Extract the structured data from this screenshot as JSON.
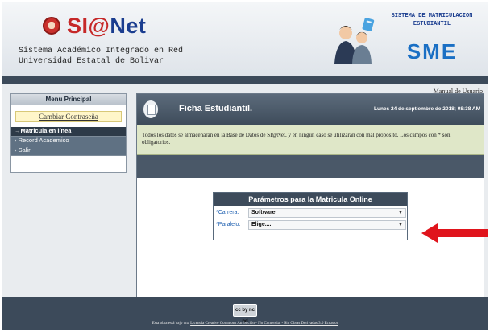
{
  "header": {
    "logo_prefix": "SI@",
    "logo_suffix": "Net",
    "tagline_line1": "Sistema Académico Integrado en Red",
    "tagline_line2": "Universidad Estatal de Bolivar",
    "sme_caption": "Sistema de matriculacion estudiantil",
    "sme_title": "SME"
  },
  "topbar": {
    "manual_label": "Manual de Usuario"
  },
  "sidebar": {
    "title": "Menu Principal",
    "change_password": "Cambiar Contraseña",
    "items": [
      {
        "label": "→Matricula en línea",
        "active": true
      },
      {
        "label": "› Record Academico",
        "active": false
      },
      {
        "label": "› Salir",
        "active": false
      }
    ]
  },
  "main": {
    "title": "Ficha Estudiantil.",
    "date": "Lunes 24 de septiembre de 2018; 08:38 AM",
    "notice": "Todos los datos se almacenarán en la Base de Datos de SI@Net, y en ningún caso se utilizarán con mal propósito. Los campos con * son obligatorios.",
    "params": {
      "title": "Parámetros para la Matricula Online",
      "fields": [
        {
          "label": "*Carrera:",
          "value": "Software"
        },
        {
          "label": "*Paralelo:",
          "value": "Elige...."
        }
      ]
    }
  },
  "footer": {
    "badge_text": "cc by nc nd",
    "license_prefix": "Esta obra está bajo una",
    "license_link": "Licencia Creative Commons Atribución - No Comercial - Sin Obras Derivadas 3.0 Ecuador"
  },
  "colors": {
    "header_dark": "#3c4a5a",
    "notice_bg": "#dfe7c8",
    "arrow": "#e0141c",
    "logo_blue": "#1a3d8f"
  },
  "icons": {
    "logo": "university-emblem-icon",
    "doc": "document-icon",
    "pointer": "red-arrow-icon"
  }
}
